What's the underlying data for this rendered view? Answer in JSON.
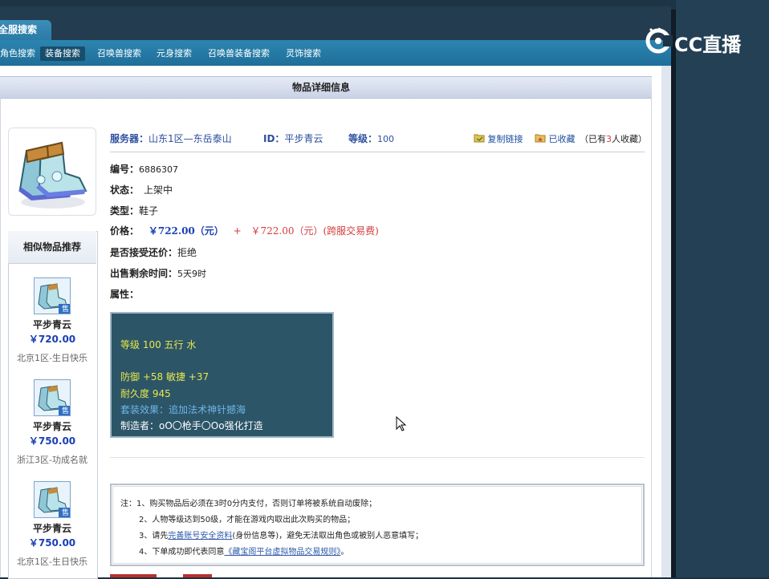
{
  "tabs": {
    "main": "全服搜索"
  },
  "nav": [
    {
      "label": "角色搜索"
    },
    {
      "label": "装备搜索"
    },
    {
      "label": "召唤兽搜索"
    },
    {
      "label": "元身搜索"
    },
    {
      "label": "召唤兽装备搜索"
    },
    {
      "label": "灵饰搜索"
    }
  ],
  "header": {
    "title": "物品详细信息"
  },
  "item": {
    "server_label": "服务器：",
    "server_value": "山东1区—东岳泰山",
    "id_label": "ID：",
    "id_value": "平步青云",
    "level_label": "等级：",
    "level_value": "100",
    "copy_link": "复制链接",
    "favorited": "已收藏",
    "fav_count_prefix": "（已有",
    "fav_count": "3",
    "fav_count_suffix": "人收藏）",
    "number_label": "编号：",
    "number_value": "6886307",
    "status_label": "状态：",
    "status_value": "上架中",
    "type_label": "类型：",
    "type_value": "鞋子",
    "price_label": "价格：",
    "price_value": "￥722.00（元）",
    "price_plus": "+",
    "price_cross": "￥722.00（元）(跨服交易费)",
    "bargain_label": "是否接受还价：",
    "bargain_value": "拒绝",
    "time_label": "出售剩余时间：",
    "time_value": "5天9时",
    "attr_label": "属性："
  },
  "attributes": {
    "line1": "等级 100 五行 水",
    "line2": "防御 +58 敏捷 +37",
    "line3": "耐久度 945",
    "line4": "套装效果：追加法术神针撼海",
    "line5": "制造者：oO〇枪手〇Oo强化打造"
  },
  "recommend": {
    "title": "相似物品推荐",
    "items": [
      {
        "name": "平步青云",
        "price": "￥720.00",
        "server": "北京1区-生日快乐"
      },
      {
        "name": "平步青云",
        "price": "￥750.00",
        "server": "浙江3区-功成名就"
      },
      {
        "name": "平步青云",
        "price": "￥750.00",
        "server": "北京1区-生日快乐"
      }
    ],
    "badge": "售"
  },
  "notice": {
    "line1": "注：1、购买物品后必须在3时0分内支付，否则订单将被系统自动废除；",
    "line2": "2、人物等级达到50级，才能在游戏内取出此次购买的物品；",
    "line3_prefix": "3、请先",
    "line3_link": "完善账号安全资料",
    "line3_suffix": "(身份信息等)，避免无法取出角色或被别人恶意填写；",
    "line4_prefix": "4、下单成功即代表同意",
    "line4_link": "《藏宝阁平台虚拟物品交易规则》",
    "line4_suffix": "。"
  },
  "overlay": {
    "logo_text": "CC直播"
  },
  "colors": {
    "price_blue": "#1a3fb5",
    "price_red": "#d43c3c",
    "attr_yellow": "#e8e84a",
    "attr_blue": "#6fb6e8"
  }
}
